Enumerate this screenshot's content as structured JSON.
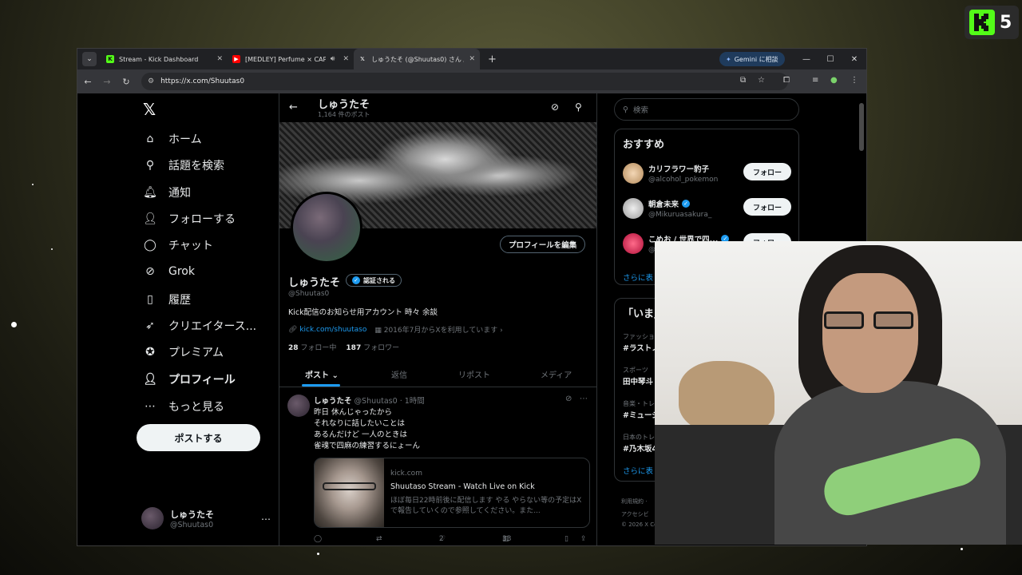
{
  "kick_badge": {
    "number": "5",
    "color": "#53fc18"
  },
  "browser": {
    "tabs": [
      {
        "title": "Stream - Kick Dashboard",
        "favicon": "kick-icon",
        "active": false
      },
      {
        "title": "[MEDLEY] Perfume × CAPS",
        "favicon": "youtube-icon",
        "active": false,
        "audio": true
      },
      {
        "title": "しゅうたそ (@Shuutas0) さん / X",
        "favicon": "x-icon",
        "active": true
      }
    ],
    "gemini_label": "Gemini に相談",
    "url": "https://x.com/Shuutas0"
  },
  "x": {
    "nav": [
      {
        "label": "ホーム",
        "icon": "home-icon"
      },
      {
        "label": "話題を検索",
        "icon": "search-icon"
      },
      {
        "label": "通知",
        "icon": "bell-icon"
      },
      {
        "label": "フォローする",
        "icon": "follow-icon"
      },
      {
        "label": "チャット",
        "icon": "chat-icon"
      },
      {
        "label": "Grok",
        "icon": "grok-icon"
      },
      {
        "label": "履歴",
        "icon": "bookmark-icon"
      },
      {
        "label": "クリエイタース...",
        "icon": "rocket-icon"
      },
      {
        "label": "プレミアム",
        "icon": "premium-icon"
      },
      {
        "label": "プロフィール",
        "icon": "profile-icon"
      },
      {
        "label": "もっと見る",
        "icon": "more-icon"
      }
    ],
    "post_button": "ポストする",
    "account": {
      "name": "しゅうたそ",
      "handle": "@Shuutas0"
    },
    "header": {
      "name": "しゅうたそ",
      "post_count": "1,164 件のポスト"
    },
    "profile": {
      "edit_button": "プロフィールを編集",
      "name": "しゅうたそ",
      "verified_label": "認証される",
      "handle": "@Shuutas0",
      "bio": "Kick配信のお知らせ用アカウント 時々 余談",
      "link": "kick.com/shuutaso",
      "joined": "2016年7月からXを利用しています",
      "following_count": "28",
      "following_label": "フォロー中",
      "followers_count": "187",
      "followers_label": "フォロワー"
    },
    "tabs": [
      "ポスト",
      "返信",
      "リポスト",
      "メディア"
    ],
    "tweet": {
      "name": "しゅうたそ",
      "meta": "@Shuutas0 · 1時間",
      "lines": [
        "昨日 休んじゃったから",
        "それなりに話したいことは",
        "あるんだけど 一人のときは",
        "雀魂で四麻の練習するにょーん"
      ],
      "card": {
        "domain": "kick.com",
        "title": "Shuutaso Stream - Watch Live on Kick",
        "desc": "ほぼ毎日22時前後に配信します やる やらない等の予定はXで報告していくので参照してください。また..."
      },
      "likes": "2",
      "views": "33"
    },
    "search_placeholder": "検索",
    "recommend": {
      "title": "おすすめ",
      "items": [
        {
          "name": "カリフラワー豹子",
          "handle": "@alcohol_pokemon",
          "verified": false
        },
        {
          "name": "朝倉未来",
          "handle": "@Mikuruasakura_",
          "verified": true
        },
        {
          "name": "こめお / 世界で四...",
          "handle": "@",
          "verified": true
        }
      ],
      "follow_label": "フォロー",
      "more": "さらに表"
    },
    "trends": {
      "title": "「いま」",
      "items": [
        {
          "category": "ファッショ",
          "name": "#ラストノ"
        },
        {
          "category": "スポーツ",
          "name": "田中琴斗"
        },
        {
          "category": "音楽・トレ",
          "name": "#ミュージ"
        },
        {
          "category": "日本のトレ",
          "name": "#乃木坂4"
        }
      ],
      "more": "さらに表"
    },
    "footer": [
      "利用規約 ·",
      "アクセシビ",
      "© 2026 X Co"
    ]
  }
}
